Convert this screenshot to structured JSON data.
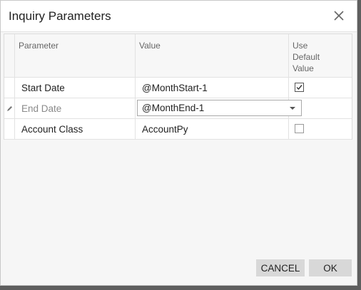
{
  "dialog": {
    "title": "Inquiry Parameters",
    "close_icon": "close-icon"
  },
  "grid": {
    "columns": [
      "Parameter",
      "Value",
      "Use Default Value"
    ],
    "rows": [
      {
        "parameter": "Start Date",
        "value": "@MonthStart-1",
        "use_default": true,
        "editing": false
      },
      {
        "parameter": "End Date",
        "value": "@MonthEnd-1",
        "use_default": false,
        "editing": true
      },
      {
        "parameter": "Account Class",
        "value": "AccountPy",
        "use_default": false,
        "editing": false
      }
    ]
  },
  "footer": {
    "cancel_label": "CANCEL",
    "ok_label": "OK"
  }
}
